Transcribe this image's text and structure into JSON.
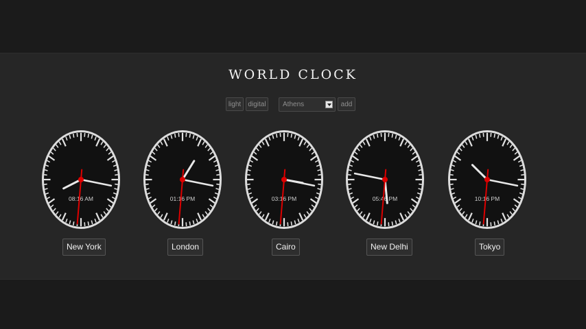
{
  "title": "WORLD CLOCK",
  "controls": {
    "light_label": "light",
    "digital_label": "digital",
    "city_select_value": "Athens",
    "add_label": "add"
  },
  "clocks": [
    {
      "city": "New York",
      "time": "08:16 AM",
      "hour": 8,
      "minute": 16,
      "second": 31
    },
    {
      "city": "London",
      "time": "01:16 PM",
      "hour": 13,
      "minute": 16,
      "second": 31
    },
    {
      "city": "Cairo",
      "time": "03:16 PM",
      "hour": 15,
      "minute": 16,
      "second": 31
    },
    {
      "city": "New Delhi",
      "time": "05:46 PM",
      "hour": 17,
      "minute": 46,
      "second": 31
    },
    {
      "city": "Tokyo",
      "time": "10:16 PM",
      "hour": 22,
      "minute": 16,
      "second": 31
    }
  ],
  "colors": {
    "face": "#111111",
    "rim": "#dddddd",
    "hands": "#e8e8e8",
    "second_hand": "#dd0000"
  }
}
